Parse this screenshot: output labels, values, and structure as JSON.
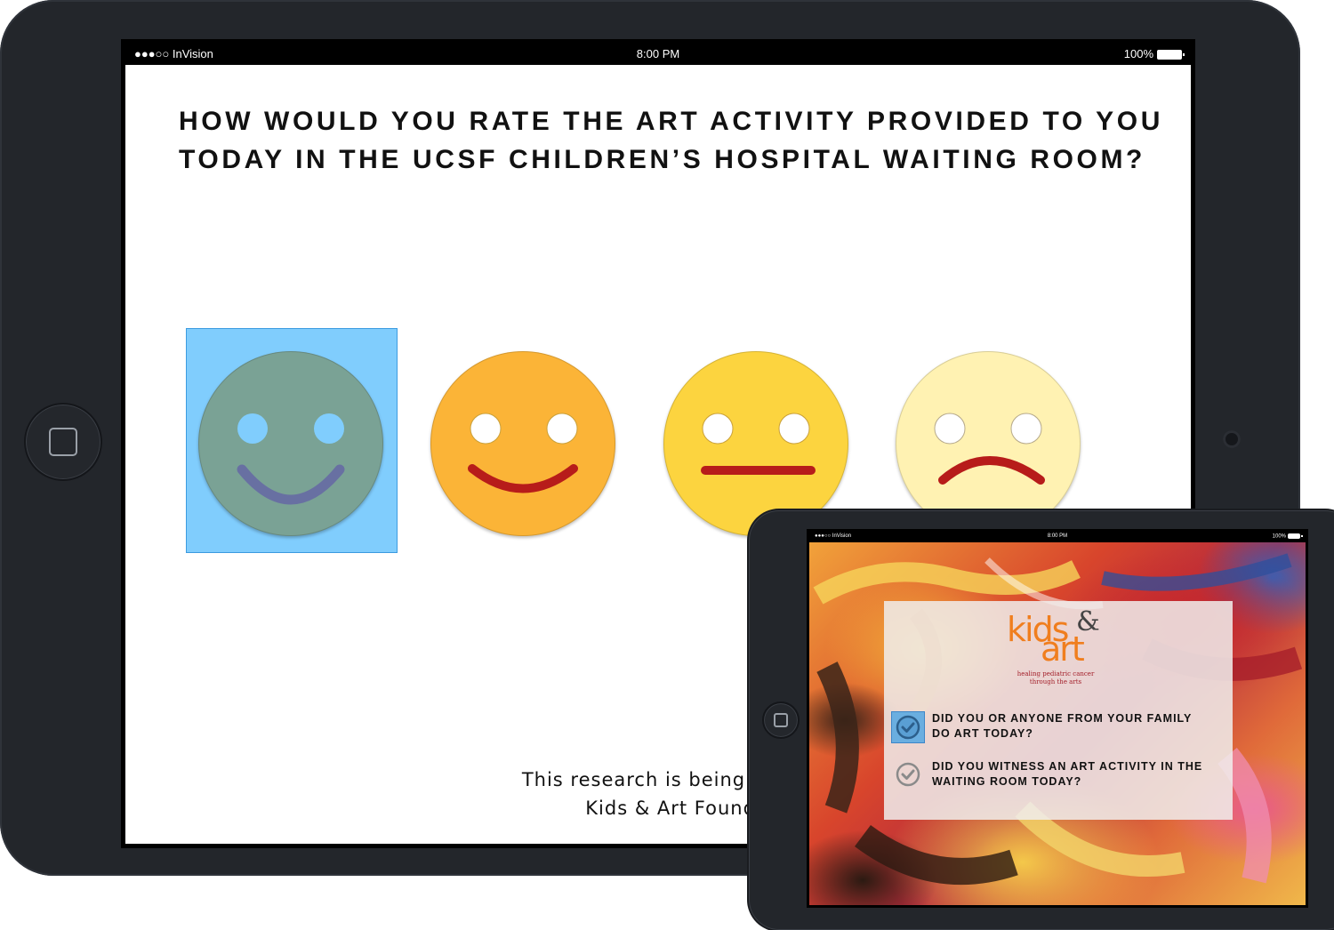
{
  "large_device": {
    "status_bar": {
      "carrier": "●●●○○ InVision",
      "time": "8:00 PM",
      "battery": "100%"
    },
    "question": "How would you rate the art activity provided to you today in the UCSF Children’s Hospital waiting room?",
    "rating_faces": [
      {
        "name": "very-happy",
        "color": "#7aa295",
        "selected": true
      },
      {
        "name": "happy",
        "color": "#fbb437",
        "selected": false
      },
      {
        "name": "neutral",
        "color": "#fcd43f",
        "selected": false
      },
      {
        "name": "sad",
        "color": "#fff2b2",
        "selected": false
      }
    ],
    "selection_color": "#80cdfd",
    "footer_line1": "This research is being conducted",
    "footer_line2": "Kids & Art Foundatio"
  },
  "small_device": {
    "status_bar": {
      "carrier": "●●●○○ InVision",
      "time": "8:00 PM",
      "battery": "100%"
    },
    "logo": {
      "kids": "kids",
      "amp": "&",
      "art": "art",
      "tagline_line1": "healing pediatric cancer",
      "tagline_line2": "through the arts"
    },
    "survey_items": [
      {
        "label_line1": "Did you or anyone from your family",
        "label_line2": "do art today?",
        "checked": true
      },
      {
        "label_line1": "Did you witness an art activity in the",
        "label_line2": "waiting room today?",
        "checked": false
      }
    ],
    "accent_color": "#f07e1e"
  }
}
